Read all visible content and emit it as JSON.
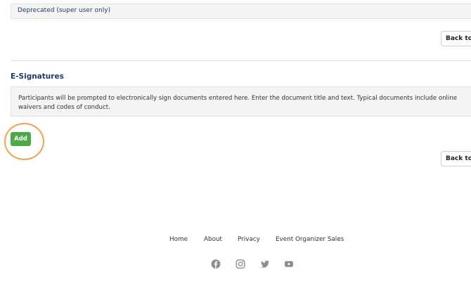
{
  "deprecated": {
    "label": "Deprecated (super user only)"
  },
  "back_button": {
    "label": "Back to Top"
  },
  "esignatures": {
    "title": "E-Signatures",
    "description": "Participants will be prompted to electronically sign documents entered here. Enter the document title and text. Typical documents include online waivers and codes of conduct.",
    "add_label": "Add"
  },
  "footer": {
    "nav": [
      "Home",
      "About",
      "Privacy",
      "Event Organizer Sales"
    ],
    "social_icons": [
      "facebook-icon",
      "instagram-icon",
      "twitter-icon",
      "youtube-icon"
    ]
  },
  "colors": {
    "accent_green": "#4fa847",
    "highlight_orange": "#f2a24a",
    "title_navy": "#1f3a6b",
    "icon_gray": "#8a8f96"
  }
}
